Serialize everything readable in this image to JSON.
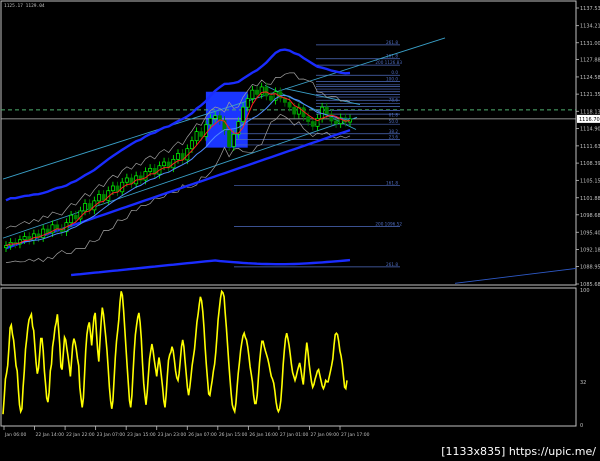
{
  "header": {
    "text": "1125.17  1129.04"
  },
  "watermark": "[1133x835] https://upic.me/",
  "colors": {
    "background": "#000000",
    "grid_axis": "#c0c0c0",
    "bull": "#00ff00",
    "bear": "#008000",
    "ma_fast": "#ff2020",
    "ma_slow": "#4f8cff",
    "bollinger": "#a0a0a0",
    "envelope": "#1a2cff",
    "trendline": "#3aa0c8",
    "fib": "#4f6cbf",
    "oscillator": "#ffff00",
    "highlight": "#1a36ff",
    "level_line": "#4fb070"
  },
  "chart_data": [
    {
      "type": "candlestick",
      "title": "",
      "y_ticks": [
        "1137.53",
        "1134.21",
        "1131.00",
        "1127.88",
        "1124.58",
        "1121.35",
        "1118.13",
        "1114.90",
        "1111.63",
        "1108.39",
        "1105.15",
        "1101.88",
        "1098.68",
        "1095.40",
        "1092.18",
        "1088.95",
        "1085.68"
      ],
      "price_label": "1116.70",
      "ylim": [
        1085.68,
        1137.53
      ],
      "x_ticks": [
        "Jan 06:00",
        "22 Jan 14:00",
        "22 Jan 22:00",
        "23 Jan 07:00",
        "23 Jan 15:00",
        "23 Jan 23:00",
        "26 Jan 07:00",
        "26 Jan 15:00",
        "26 Jan 16:00",
        "27 Jan 01:00",
        "27 Jan 09:00",
        "27 Jan 17:00"
      ],
      "fib_labels": [
        "261.8",
        "161.8",
        "200 1126.83",
        "0.0",
        "100.0",
        "78.6",
        "61.8",
        "50.0",
        "38.2",
        "23.6",
        "161.8",
        "200 1096.52",
        "261.8"
      ],
      "close": [
        1092.9,
        1093.5,
        1093.2,
        1094.0,
        1094.6,
        1093.9,
        1095.1,
        1094.4,
        1096.0,
        1095.3,
        1096.8,
        1096.1,
        1095.5,
        1097.2,
        1098.6,
        1097.9,
        1099.4,
        1100.8,
        1099.6,
        1101.3,
        1102.5,
        1101.4,
        1103.2,
        1104.1,
        1103.0,
        1104.8,
        1105.6,
        1104.5,
        1106.0,
        1105.2,
        1106.8,
        1107.4,
        1106.3,
        1107.9,
        1108.6,
        1107.5,
        1109.1,
        1110.2,
        1109.0,
        1111.1,
        1112.6,
        1114.3,
        1113.4,
        1115.6,
        1116.8,
        1117.3,
        1116.4,
        1114.5,
        1111.5,
        1113.8,
        1116.2,
        1118.9,
        1120.5,
        1122.1,
        1121.3,
        1122.7,
        1121.0,
        1120.2,
        1121.8,
        1120.6,
        1119.8,
        1118.9,
        1117.6,
        1118.8,
        1117.1,
        1116.2,
        1115.3,
        1116.8,
        1118.9,
        1117.6,
        1116.3,
        1115.8,
        1116.9,
        1116.1,
        1116.7
      ],
      "series": [
        {
          "name": "",
          "kind": "ma_fast"
        },
        {
          "name": "",
          "kind": "ma_slow"
        }
      ]
    },
    {
      "type": "line",
      "title": "",
      "y_ticks": [
        "100",
        "32",
        "0"
      ],
      "ylim": [
        0,
        100
      ],
      "values": [
        8,
        20,
        34,
        38,
        44,
        57,
        72,
        74,
        67,
        63,
        54,
        44,
        40,
        26,
        15,
        10,
        12,
        28,
        40,
        56,
        63,
        72,
        78,
        80,
        82,
        73,
        70,
        58,
        46,
        38,
        42,
        52,
        64,
        64,
        55,
        40,
        30,
        20,
        17,
        24,
        40,
        45,
        58,
        64,
        72,
        76,
        82,
        71,
        60,
        43,
        41,
        53,
        65,
        63,
        57,
        51,
        44,
        36,
        48,
        59,
        64,
        61,
        56,
        49,
        44,
        28,
        20,
        13,
        20,
        38,
        55,
        67,
        73,
        76,
        68,
        59,
        70,
        80,
        83,
        69,
        56,
        47,
        61,
        76,
        87,
        82,
        73,
        65,
        55,
        42,
        28,
        18,
        12,
        18,
        34,
        50,
        62,
        70,
        78,
        91,
        99,
        96,
        85,
        71,
        58,
        44,
        31,
        18,
        13,
        22,
        38,
        54,
        67,
        74,
        80,
        83,
        76,
        64,
        46,
        31,
        22,
        15,
        24,
        37,
        49,
        55,
        60,
        55,
        48,
        42,
        36,
        44,
        50,
        44,
        36,
        28,
        18,
        13,
        22,
        36,
        48,
        52,
        54,
        58,
        55,
        48,
        40,
        35,
        33,
        38,
        48,
        58,
        63,
        58,
        48,
        38,
        28,
        22,
        28,
        36,
        44,
        50,
        56,
        66,
        76,
        82,
        89,
        95,
        92,
        84,
        72,
        58,
        45,
        34,
        23,
        22,
        28,
        33,
        40,
        45,
        54,
        66,
        78,
        86,
        94,
        99,
        98,
        95,
        83,
        72,
        59,
        46,
        34,
        23,
        15,
        12,
        10,
        16,
        28,
        38,
        46,
        55,
        61,
        66,
        68,
        65,
        63,
        58,
        51,
        43,
        38,
        32,
        22,
        16,
        16,
        22,
        34,
        46,
        55,
        62,
        62,
        58,
        55,
        52,
        49,
        45,
        40,
        36,
        34,
        31,
        25,
        17,
        12,
        10,
        12,
        18,
        30,
        45,
        55,
        64,
        68,
        64,
        59,
        52,
        45,
        39,
        36,
        33,
        36,
        40,
        43,
        46,
        41,
        35,
        30,
        40,
        52,
        61,
        54,
        45,
        38,
        32,
        28,
        30,
        34,
        37,
        40,
        41,
        37,
        33,
        29,
        27,
        29,
        33,
        32,
        32,
        36,
        40,
        44,
        49,
        59,
        67,
        68,
        67,
        62,
        55,
        51,
        45,
        36,
        28,
        27,
        33
      ]
    }
  ]
}
